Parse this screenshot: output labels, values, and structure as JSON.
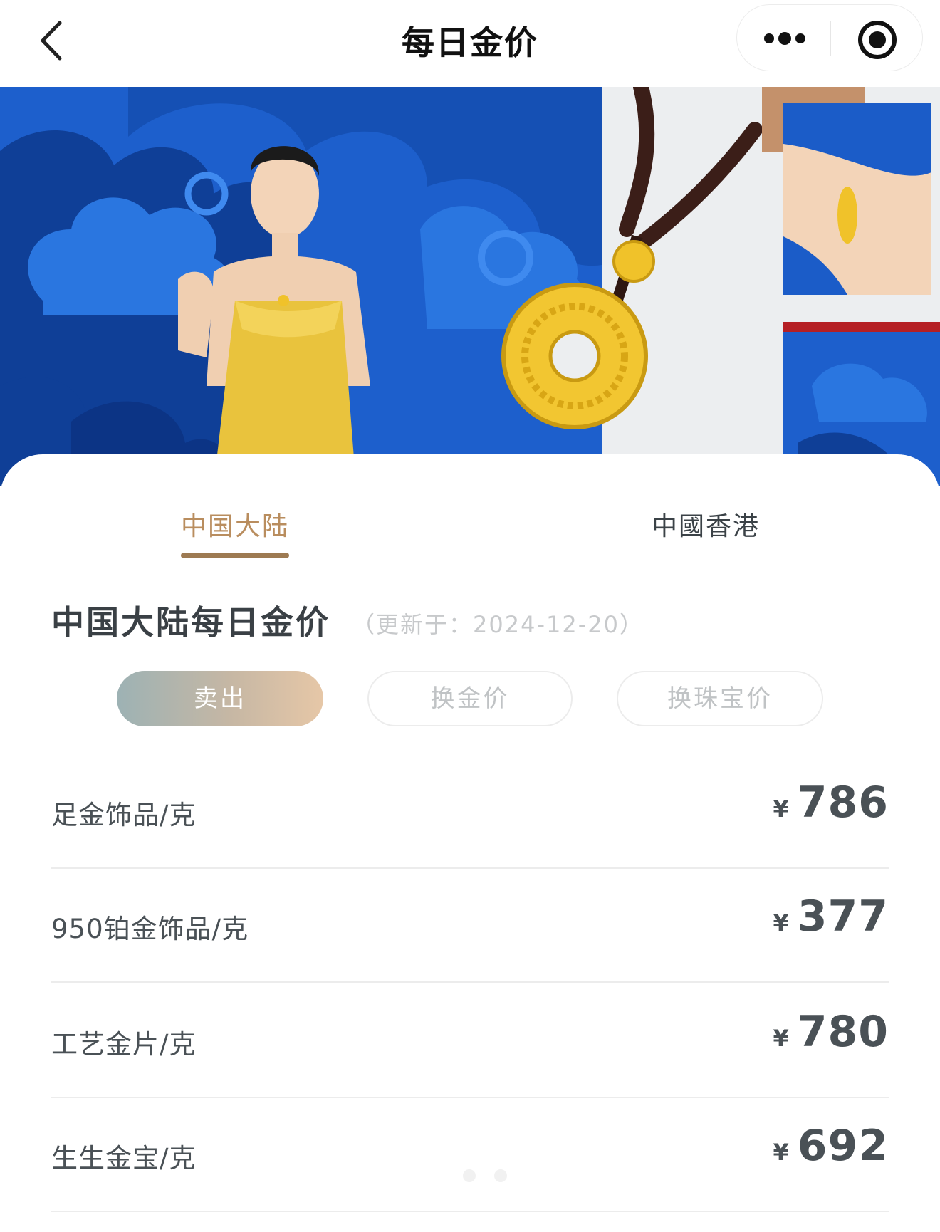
{
  "nav": {
    "title": "每日金价",
    "back_icon": "chevron-left-icon",
    "more_icon": "more-dots-icon",
    "close_icon": "target-close-icon"
  },
  "banner": {
    "description_icon": "jewelry-promo-banner"
  },
  "tabs": [
    {
      "label": "中国大陆",
      "active": true
    },
    {
      "label": "中國香港",
      "active": false
    }
  ],
  "section": {
    "title": "中国大陆每日金价",
    "update_note": "（更新于：2024-12-20）"
  },
  "price_types": [
    {
      "label": "卖出",
      "active": true
    },
    {
      "label": "换金价",
      "active": false
    },
    {
      "label": "换珠宝价",
      "active": false
    }
  ],
  "prices": [
    {
      "name": "足金饰品/克",
      "currency": "¥",
      "amount": "786"
    },
    {
      "name": "950铂金饰品/克",
      "currency": "¥",
      "amount": "377"
    },
    {
      "name": "工艺金片/克",
      "currency": "¥",
      "amount": "780"
    },
    {
      "name": "生生金宝/克",
      "currency": "¥",
      "amount": "692"
    }
  ],
  "colors": {
    "accent": "#b98d5e",
    "tab_underline": "#9d7a52",
    "banner_blue": "#1b5cc8",
    "gold": "#f0c22a"
  }
}
